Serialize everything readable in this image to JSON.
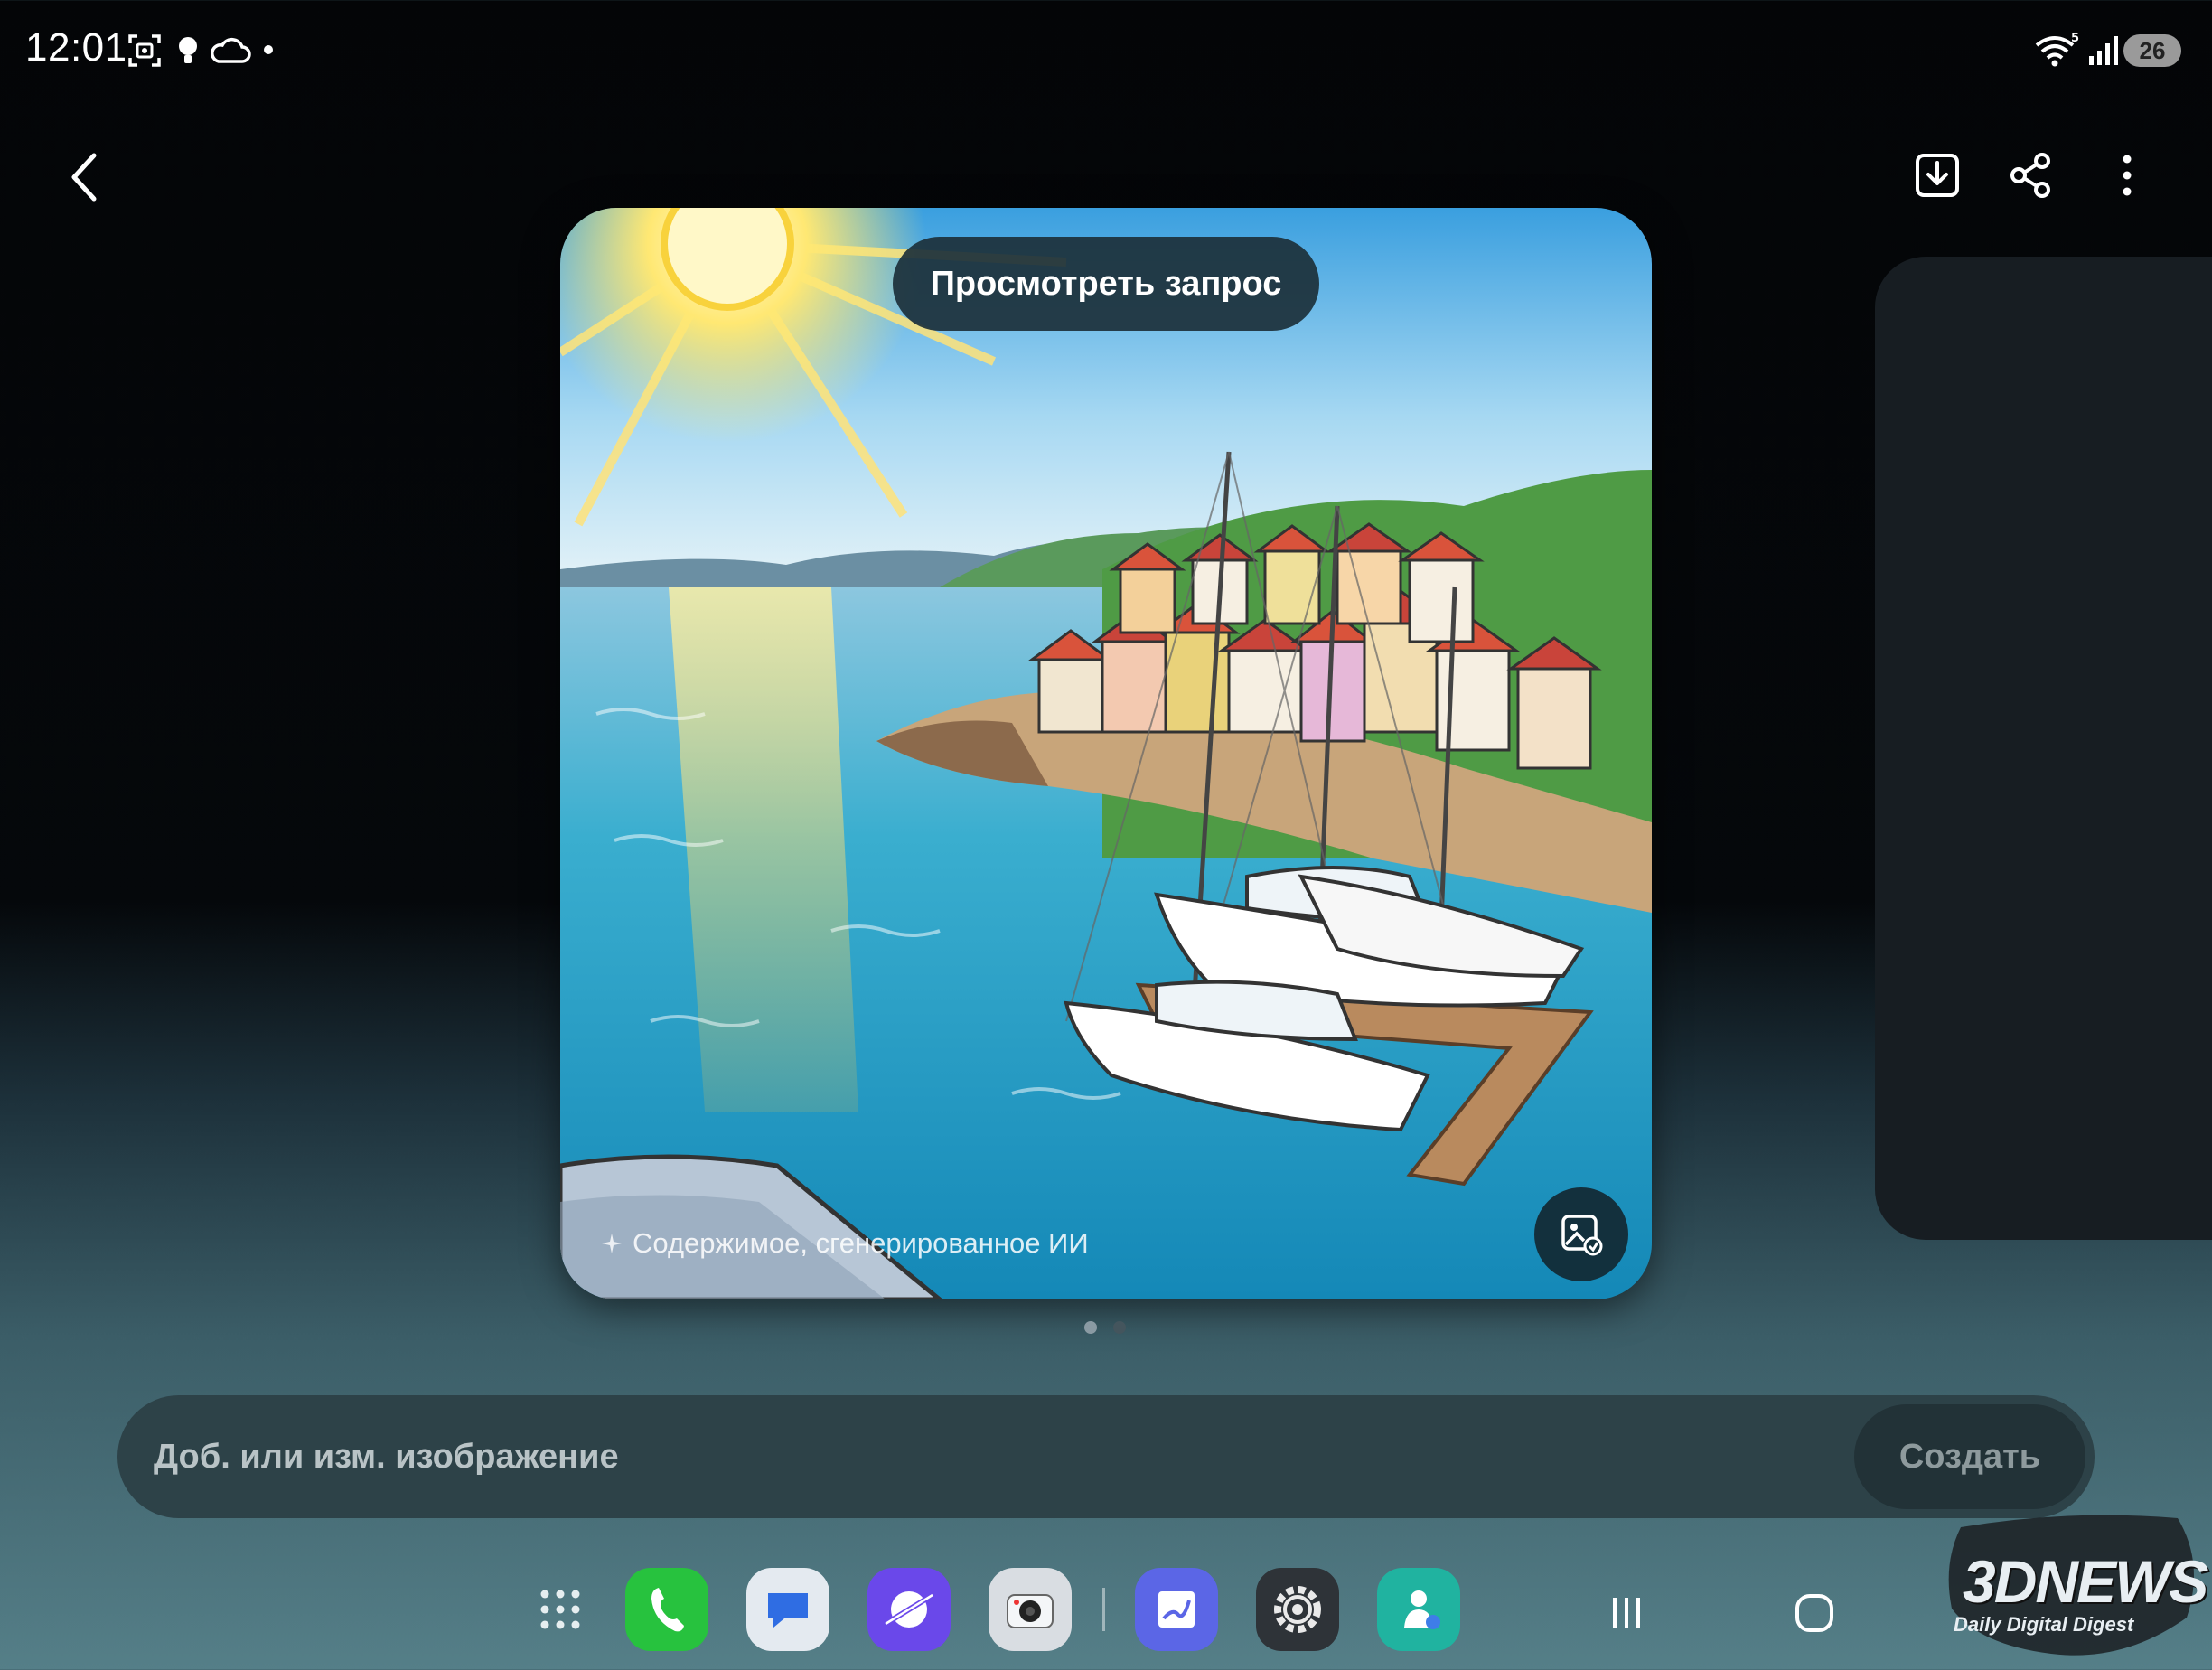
{
  "status_bar": {
    "time": "12:01",
    "battery": "26",
    "icons": [
      "screen-capture-icon",
      "lightbulb-icon",
      "cloud-icon",
      "notification-dot",
      "wifi-icon",
      "signal-icon",
      "battery-icon"
    ]
  },
  "toolbar": {
    "back_icon": "chevron-left-icon",
    "download_icon": "download-icon",
    "share_icon": "share-icon",
    "more_icon": "more-vertical-icon"
  },
  "image": {
    "view_prompt_label": "Просмотреть запрос",
    "ai_label": "Содержимое, сгенерированное ИИ",
    "edit_icon": "edit-image-icon"
  },
  "pagination": {
    "count": 2,
    "active": 1
  },
  "prompt_input": {
    "placeholder": "Доб. или изм. изображение",
    "create_label": "Создать"
  },
  "dock": {
    "apps": [
      "apps-grid-icon",
      "phone-app-icon",
      "messages-app-icon",
      "internet-app-icon",
      "camera-app-icon",
      "notes-app-icon",
      "settings-app-icon",
      "bixby-app-icon"
    ],
    "nav": [
      "recents-icon",
      "home-icon",
      "back-icon"
    ]
  },
  "watermark": {
    "title": "3DNEWS",
    "subtitle": "Daily Digital Digest"
  },
  "colors": {
    "accent_green": "#2ecc40",
    "panel": "#171d22",
    "input_bg": "#2d4248"
  }
}
